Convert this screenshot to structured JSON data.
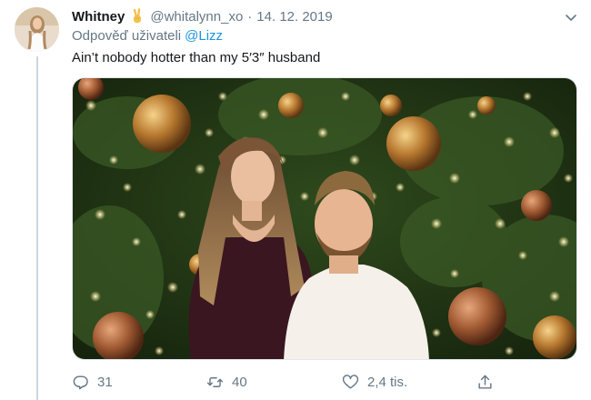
{
  "tweet": {
    "author_name": "Whitney",
    "author_emoji_icon": "victory-hand-icon",
    "handle": "@whitalynn_xo",
    "separator": "·",
    "date": "14. 12. 2019",
    "reply_prefix": "Odpověď uživateli",
    "reply_mention": "@Lizz",
    "text": "Ain’t nobody hotter than my 5′3″ husband"
  },
  "actions": {
    "reply_count": "31",
    "retweet_count": "40",
    "like_count": "2,4 tis."
  },
  "colors": {
    "text": "#14171a",
    "secondary": "#657786",
    "link": "#1b95e0",
    "thread_line": "#ccd6dd"
  },
  "icons": [
    "chevron-down-icon",
    "reply-icon",
    "retweet-icon",
    "heart-icon",
    "share-icon"
  ]
}
